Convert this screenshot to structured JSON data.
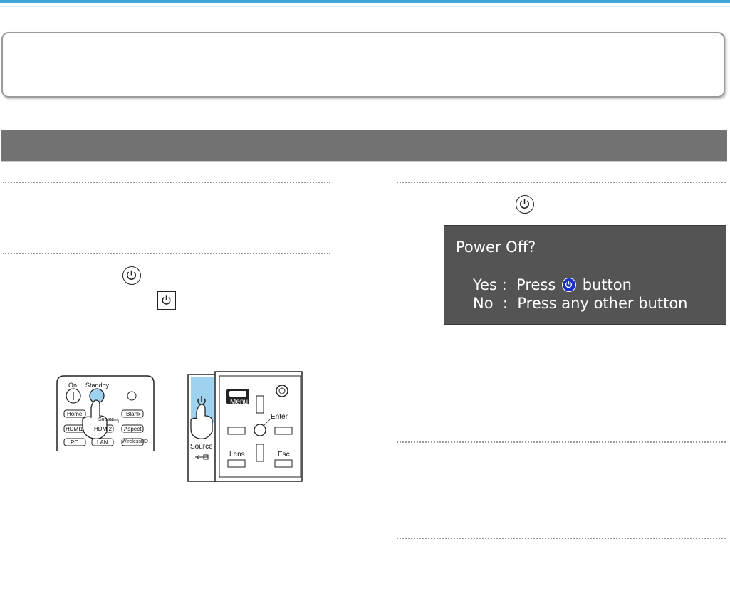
{
  "dialog": {
    "title": "Power Off?",
    "yes_key": "Yes",
    "yes_sep": ":",
    "yes_action": "Press",
    "yes_suffix": "button",
    "no_key": "No",
    "no_sep": ":",
    "no_action": "Press any other button"
  },
  "remote": {
    "on_label": "On",
    "standby_label": "Standby",
    "home": "Home",
    "blank": "Blank",
    "source": "Source",
    "hdmi1": "HDMI1",
    "hdmi2": "HDMI2",
    "aspect": "Aspect",
    "pc": "PC",
    "lan": "LAN",
    "wireless": "WirelessHD"
  },
  "panel": {
    "menu": "Menu",
    "enter": "Enter",
    "lens": "Lens",
    "esc": "Esc",
    "source": "Source"
  },
  "colors": {
    "accent": "#3fa7d6",
    "section_bar": "#727272",
    "dialog_bg": "#545454",
    "highlight": "#9fd2ee",
    "power_button_blue": "#1a2fc9"
  }
}
